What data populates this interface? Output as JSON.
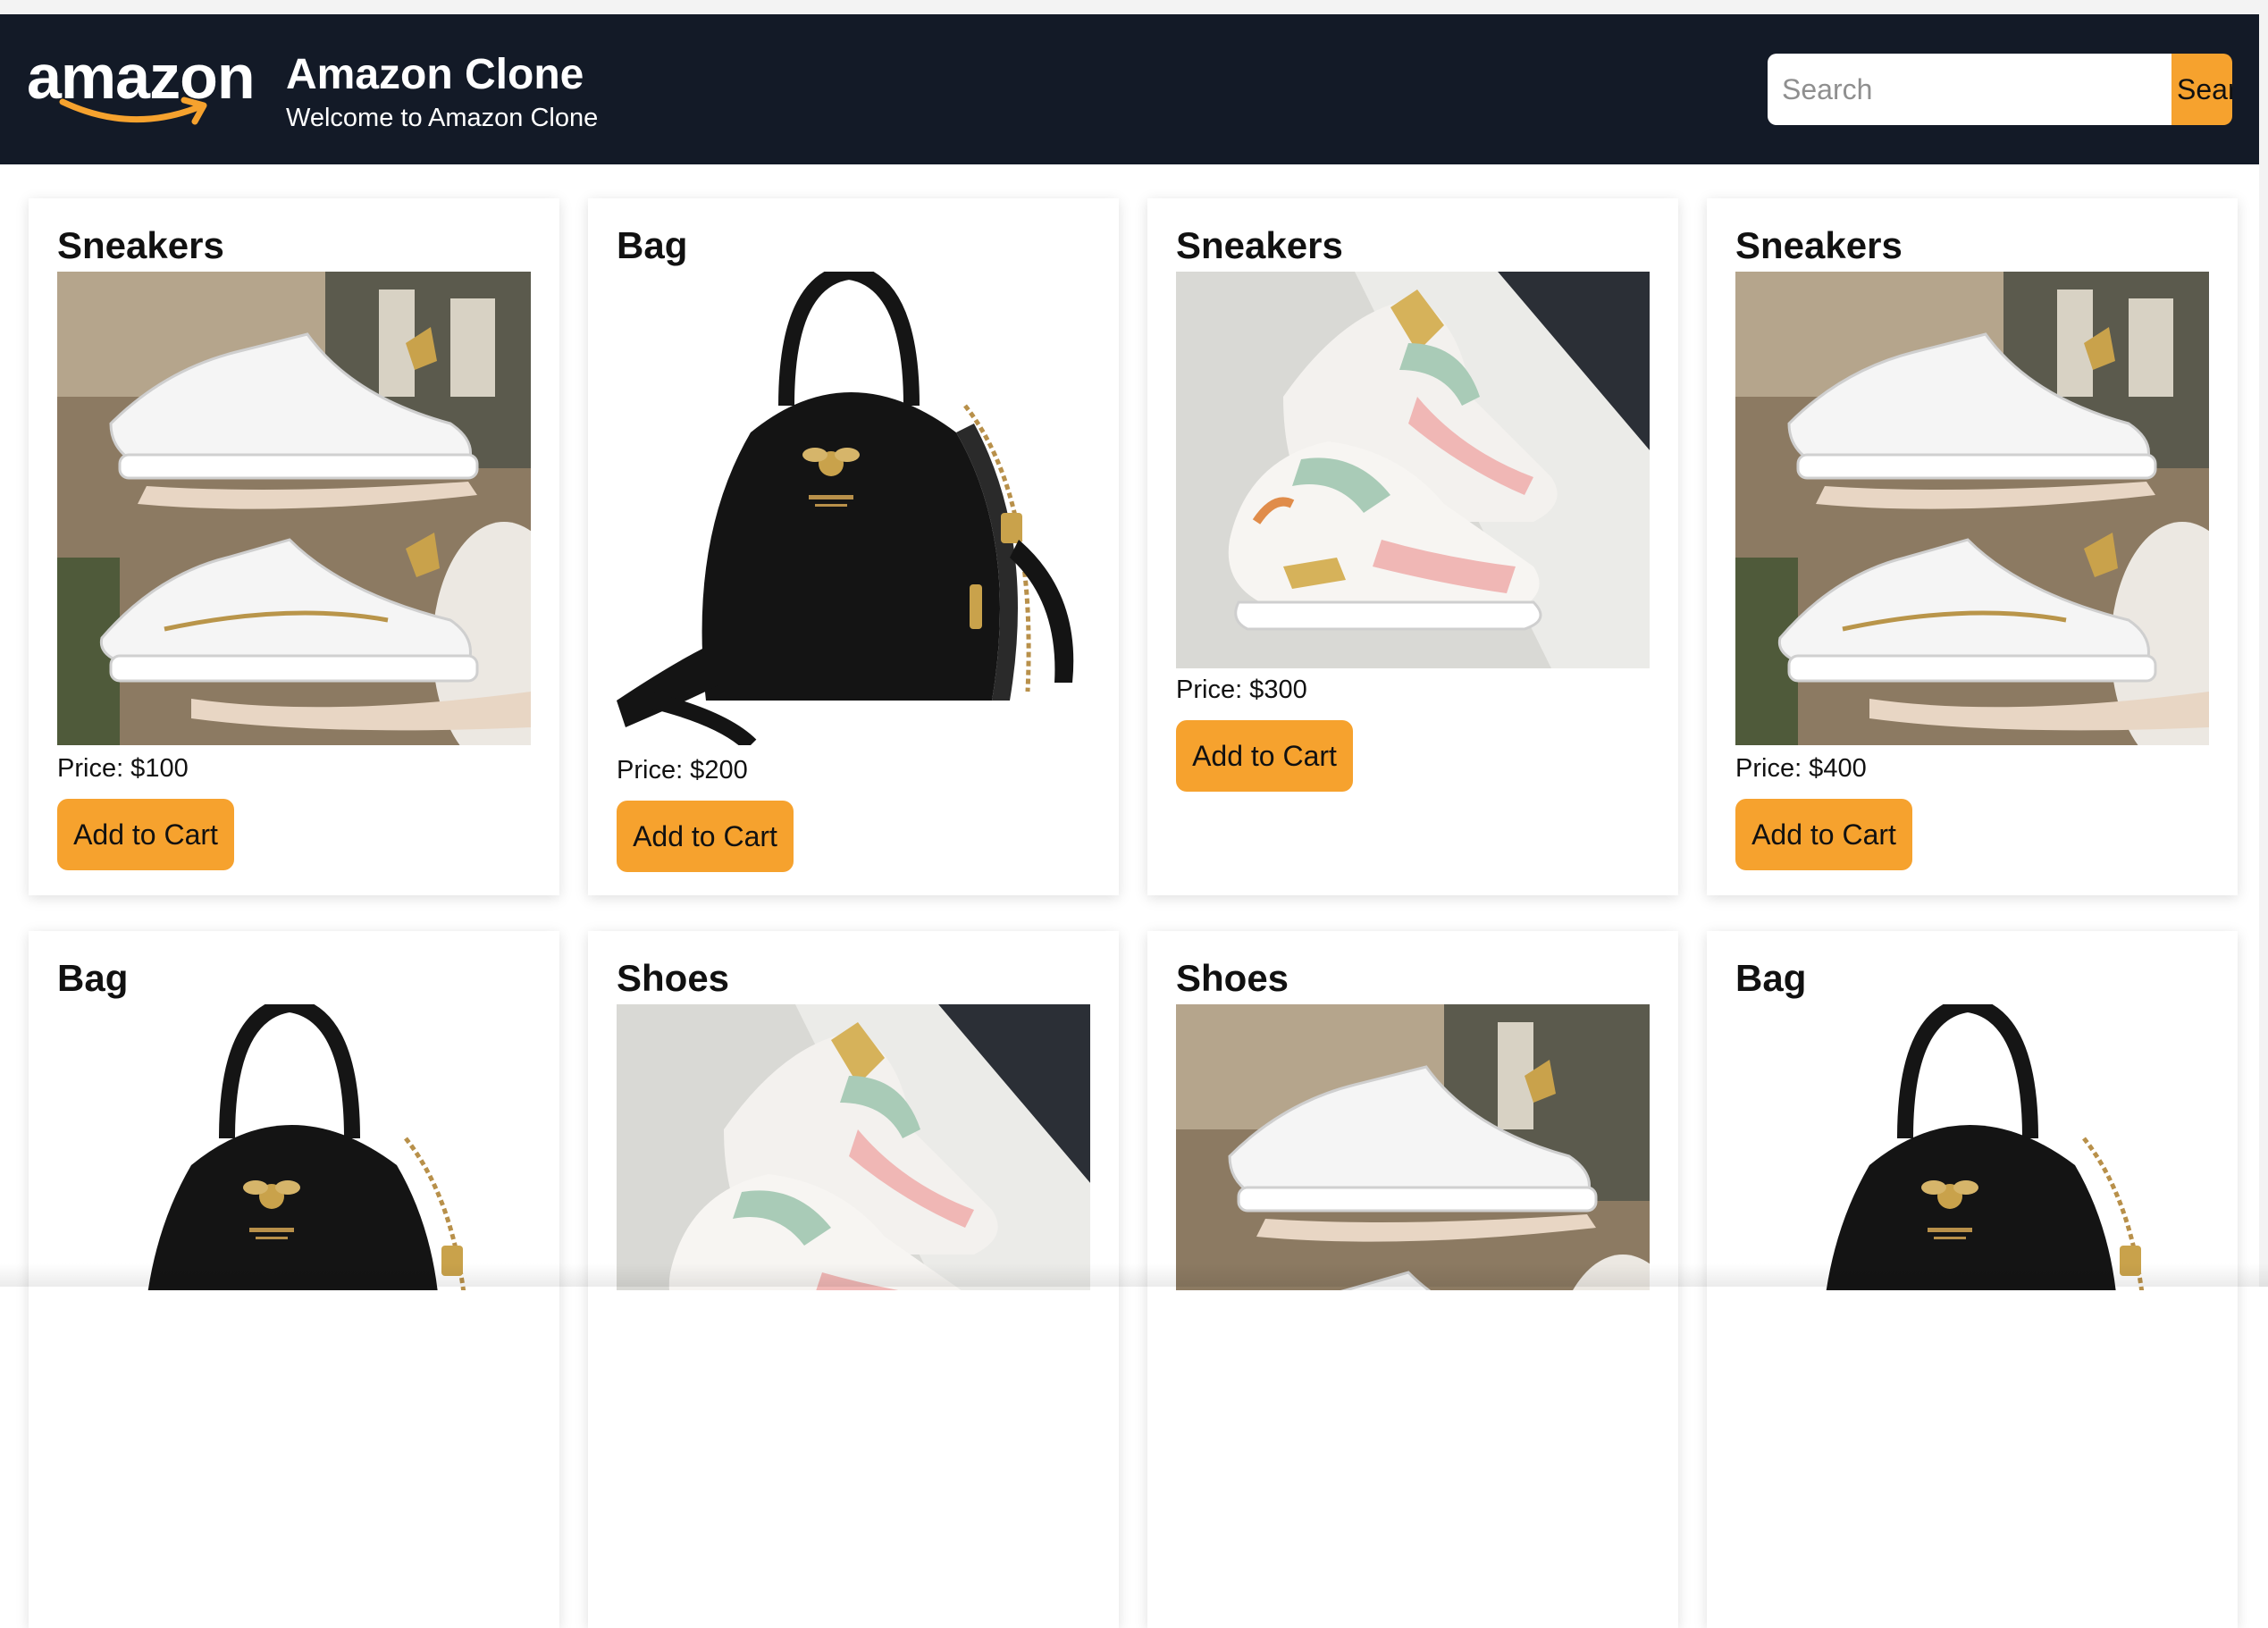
{
  "header": {
    "logo_text": "amazon",
    "title": "Amazon Clone",
    "subtitle": "Welcome to Amazon Clone",
    "search_placeholder": "Search",
    "search_button": "Search"
  },
  "products": [
    {
      "title": "Sneakers",
      "image": "white-sneakers",
      "price": "Price: $100",
      "button": "Add to Cart"
    },
    {
      "title": "Bag",
      "image": "black-bag",
      "price": "Price: $200",
      "button": "Add to Cart"
    },
    {
      "title": "Sneakers",
      "image": "pastel-sneakers",
      "price": "Price: $300",
      "button": "Add to Cart"
    },
    {
      "title": "Sneakers",
      "image": "white-sneakers",
      "price": "Price: $400",
      "button": "Add to Cart"
    },
    {
      "title": "Bag",
      "image": "black-bag"
    },
    {
      "title": "Shoes",
      "image": "pastel-sneakers"
    },
    {
      "title": "Shoes",
      "image": "white-sneakers"
    },
    {
      "title": "Bag",
      "image": "black-bag"
    }
  ],
  "colors": {
    "header_bg": "#131a27",
    "accent": "#f6a22e"
  }
}
